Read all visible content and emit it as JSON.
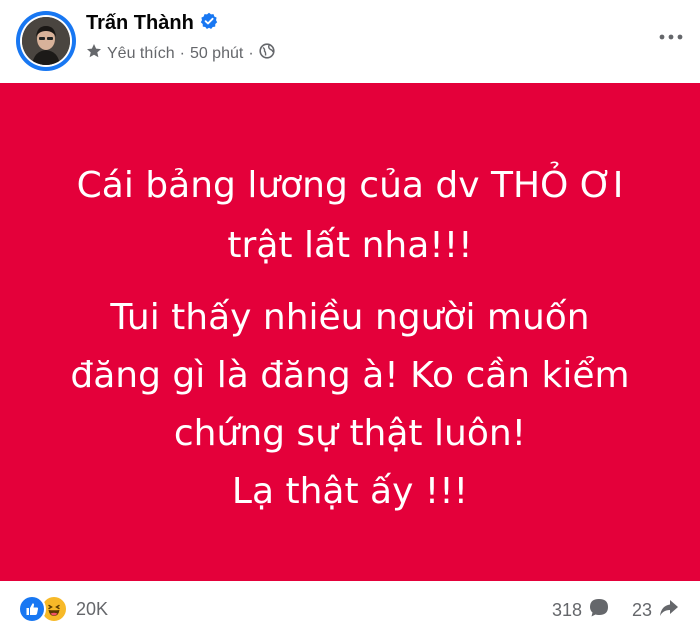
{
  "post": {
    "author": {
      "name": "Trấn Thành",
      "verified": true
    },
    "meta": {
      "label": "Yêu thích",
      "time": "50 phút",
      "separator": "·",
      "audience_icon": "globe-icon"
    },
    "menu_icon": "more-horizontal-icon",
    "background_color": "#e4003a",
    "text_color": "#ffffff",
    "content": {
      "paragraph_1": [
        "Cái bảng lương của dv THỎ ƠI",
        "trật lất nha!!!"
      ],
      "paragraph_2": [
        "Tui thấy nhiều người muốn",
        "đăng gì là đăng à! Ko cần kiểm",
        "chứng sự thật luôn!",
        "Lạ thật ấy !!!"
      ]
    },
    "footer": {
      "reaction_icons": [
        "like-reaction-icon",
        "haha-reaction-icon"
      ],
      "reaction_count": "20K",
      "comment_count": "318",
      "share_count": "23"
    }
  }
}
